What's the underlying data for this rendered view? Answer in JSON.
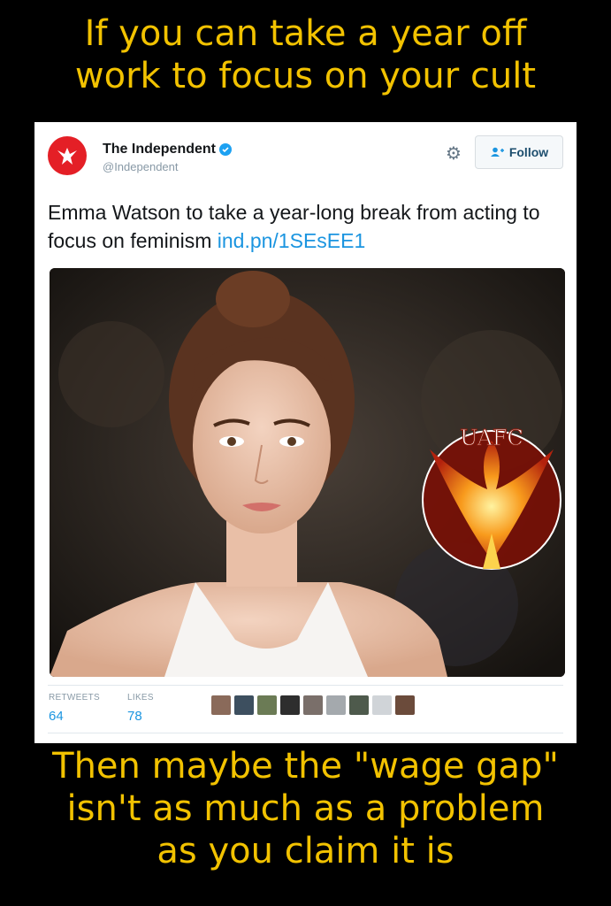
{
  "top_caption": {
    "line1": "If you can take a year off",
    "line2": "work to focus on your cult"
  },
  "tweet": {
    "account_name": "The Independent",
    "handle": "@Independent",
    "follow_label": "Follow",
    "text": "Emma Watson to take a year-long break from acting to focus on feminism ",
    "link": "ind.pn/1SEsEE1",
    "retweets_label": "RETWEETS",
    "retweets_count": "64",
    "likes_label": "LIKES",
    "likes_count": "78",
    "watermark_text": "UAFC"
  },
  "bottom_caption": {
    "line1": "Then maybe the \"wage gap\"",
    "line2": "isn't as much as a problem",
    "line3": "as you claim it is"
  },
  "colors": {
    "caption": "#f2c200",
    "brand_red": "#e41f26",
    "link_blue": "#1b95e0"
  }
}
